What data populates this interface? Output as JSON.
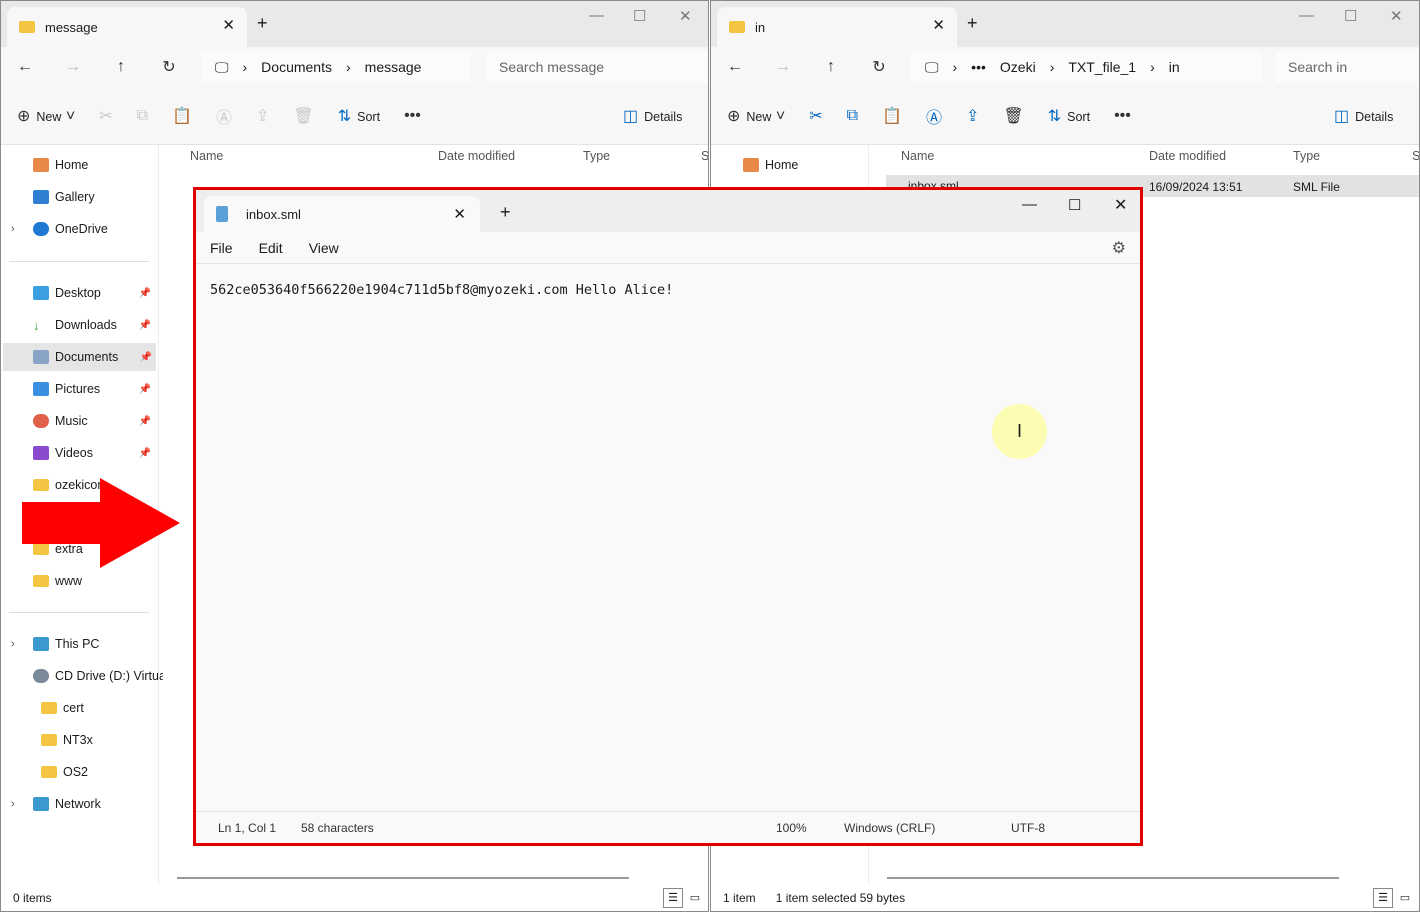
{
  "left_explorer": {
    "tab_title": "message",
    "breadcrumb": [
      "Documents",
      "message"
    ],
    "search_placeholder": "Search message",
    "toolbar": {
      "new": "New",
      "sort": "Sort",
      "more": "•••",
      "details": "Details"
    },
    "columns": [
      "Name",
      "Date modified",
      "Type",
      "S"
    ],
    "sidebar": [
      {
        "label": "Home"
      },
      {
        "label": "Gallery"
      },
      {
        "label": "OneDrive"
      },
      {
        "label": "Desktop"
      },
      {
        "label": "Downloads"
      },
      {
        "label": "Documents"
      },
      {
        "label": "Pictures"
      },
      {
        "label": "Music"
      },
      {
        "label": "Videos"
      },
      {
        "label": "ozekicon"
      },
      {
        "label": "extra"
      },
      {
        "label": "www"
      },
      {
        "label": "This PC"
      },
      {
        "label": "CD Drive (D:) Virtua"
      },
      {
        "label": "cert"
      },
      {
        "label": "NT3x"
      },
      {
        "label": "OS2"
      },
      {
        "label": "Network"
      }
    ],
    "status": "0 items"
  },
  "right_explorer": {
    "tab_title": "in",
    "breadcrumb": [
      "•••",
      "Ozeki",
      "TXT_file_1",
      "in"
    ],
    "search_placeholder": "Search in",
    "toolbar": {
      "new": "New",
      "sort": "Sort",
      "more": "•••",
      "details": "Details"
    },
    "columns": [
      "Name",
      "Date modified",
      "Type",
      "S"
    ],
    "sidebar": [
      {
        "label": "Home"
      }
    ],
    "files": [
      {
        "name": "inbox.sml",
        "date": "16/09/2024 13:51",
        "type": "SML File"
      }
    ],
    "status": {
      "items": "1 item",
      "selected": "1 item selected  59 bytes"
    }
  },
  "notepad": {
    "tab_title": "inbox.sml",
    "menu": [
      "File",
      "Edit",
      "View"
    ],
    "content": "562ce053640f566220e1904c711d5bf8@myozeki.com Hello Alice!",
    "status": {
      "position": "Ln 1, Col 1",
      "chars": "58 characters",
      "zoom": "100%",
      "line_ending": "Windows (CRLF)",
      "encoding": "UTF-8"
    }
  },
  "colors": {
    "highlight": "#e00000",
    "accent": "#0067c0",
    "folder": "#f4c542"
  }
}
